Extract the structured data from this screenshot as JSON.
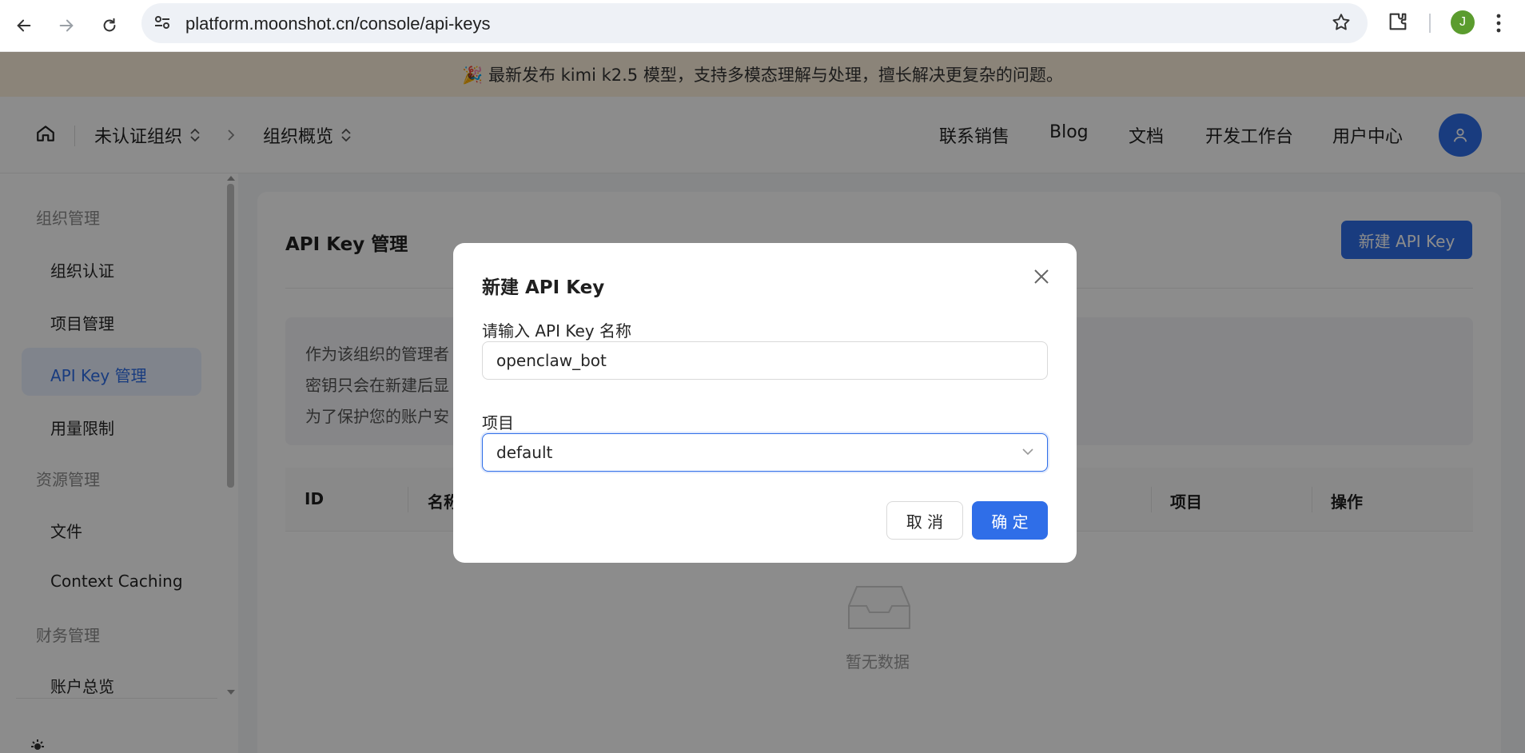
{
  "browser": {
    "url": "platform.moonshot.cn/console/api-keys",
    "profile_initial": "J",
    "profile_color": "#5b9c2e"
  },
  "announcement": "🎉 最新发布 kimi k2.5 模型，支持多模态理解与处理，擅长解决更复杂的问题。",
  "header": {
    "org": "未认证组织",
    "section": "组织概览",
    "links": [
      "联系销售",
      "Blog",
      "文档",
      "开发工作台",
      "用户中心"
    ]
  },
  "sidebar": {
    "groups": [
      {
        "title": "组织管理",
        "items": [
          "组织认证",
          "项目管理",
          "API Key 管理",
          "用量限制"
        ]
      },
      {
        "title": "资源管理",
        "items": [
          "文件",
          "Context Caching"
        ]
      },
      {
        "title": "财务管理",
        "items": [
          "账户总览"
        ]
      }
    ],
    "active_item": "API Key 管理"
  },
  "page": {
    "title": "API Key 管理",
    "new_button": "新建 API Key",
    "info_lines": [
      "作为该组织的管理者",
      "密钥只会在新建后显",
      "为了保护您的账户安"
    ],
    "table": {
      "columns": [
        "ID",
        "名称",
        "项目",
        "操作"
      ]
    },
    "empty_text": "暂无数据"
  },
  "modal": {
    "title": "新建 API Key",
    "name_label": "请输入 API Key 名称",
    "name_value": "openclaw_bot",
    "project_label": "项目",
    "project_value": "default",
    "cancel_label": "取 消",
    "ok_label": "确 定"
  },
  "colors": {
    "accent": "#2f6ee8",
    "announcement_bg": "#fdf1dc",
    "active_bg": "#eaf1ff"
  }
}
